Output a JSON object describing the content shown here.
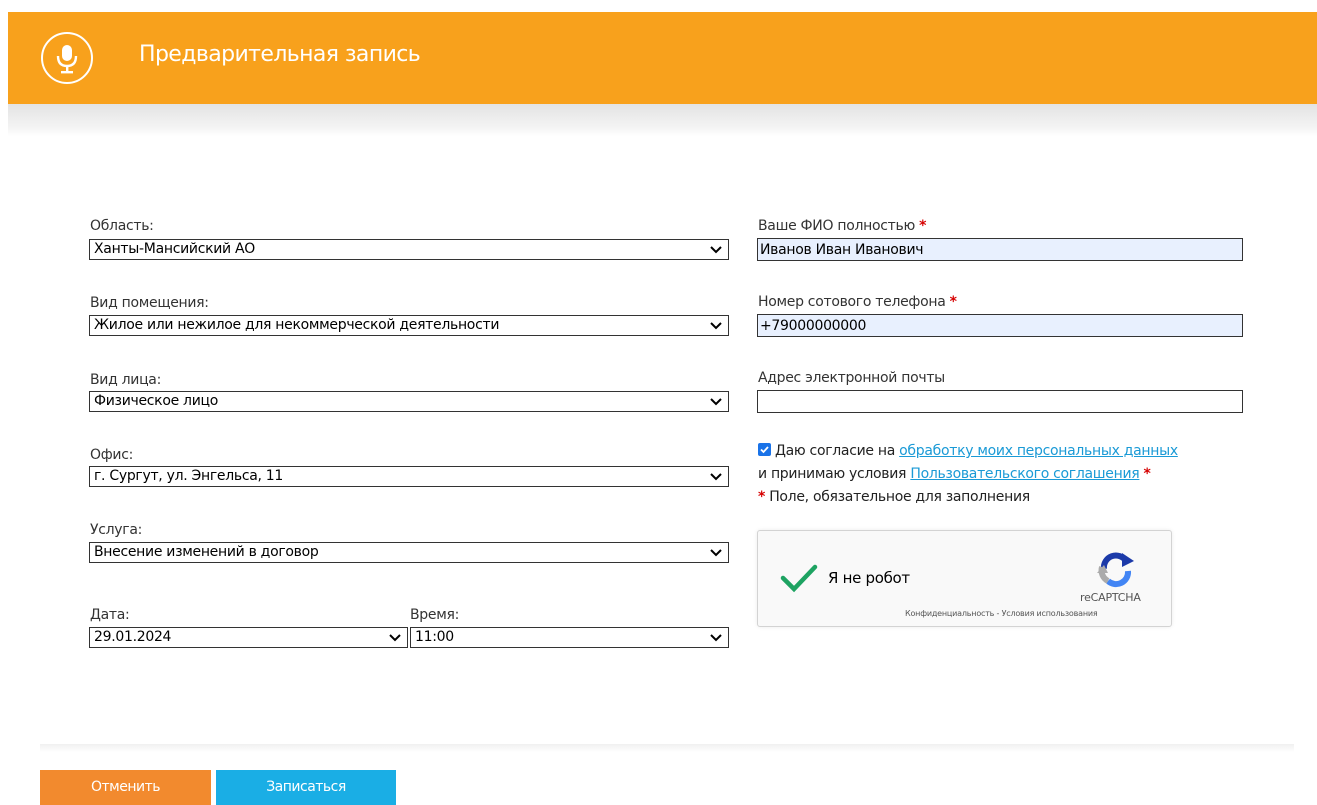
{
  "header": {
    "title": "Предварительная запись",
    "icon": "microphone-icon",
    "accent_color": "#f8a11c"
  },
  "form": {
    "region": {
      "label": "Область:",
      "value": "Ханты-Мансийский АО"
    },
    "premises": {
      "label": "Вид помещения:",
      "value": "Жилое или нежилое для некоммерческой деятельности"
    },
    "person": {
      "label": "Вид лица:",
      "value": "Физическое лицо"
    },
    "office": {
      "label": "Офис:",
      "value": "г. Сургут, ул. Энгельса, 11"
    },
    "service": {
      "label": "Услуга:",
      "value": "Внесение изменений в договор"
    },
    "date": {
      "label": "Дата:",
      "value": "29.01.2024"
    },
    "time": {
      "label": "Время:",
      "value": "11:00"
    },
    "fullname": {
      "label": "Ваше ФИО полностью",
      "value": "Иванов Иван Иванович"
    },
    "phone": {
      "label": "Номер сотового телефона",
      "value": "+79000000000"
    },
    "email": {
      "label": "Адрес электронной почты",
      "value": ""
    },
    "required_mark": "*"
  },
  "consent": {
    "checked": true,
    "text1": "Даю согласие на",
    "link1": "обработку моих персональных данных",
    "text2": "и принимаю условия",
    "link2": "Пользовательского соглашения",
    "required_note": "Поле, обязательное для заполнения"
  },
  "recaptcha": {
    "label": "Я не робот",
    "brand": "reCAPTCHA",
    "terms": "Конфиденциальность - Условия использования",
    "checked": true
  },
  "buttons": {
    "cancel": "Отменить",
    "submit": "Записаться",
    "cancel_color": "#f28a2e",
    "submit_color": "#1aaee5"
  }
}
